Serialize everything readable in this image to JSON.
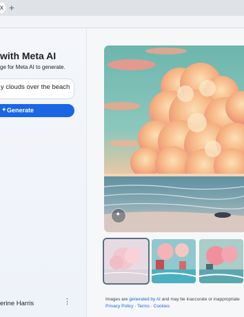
{
  "browser": {
    "tab_close": "x",
    "new_tab": "+"
  },
  "sidebar": {
    "title": "with Meta AI",
    "subtitle": "ge for Meta AI to generate.",
    "prompt_value": "y clouds over the beach",
    "generate_label": "Generate",
    "user_name": "erine Harris",
    "more_label": "⋮"
  },
  "main": {
    "disclaimer_pre": "Images are ",
    "disclaimer_link": "generated by AI",
    "disclaimer_post": " and may be inaccurate or inappropriate",
    "privacy": "Privacy Policy",
    "sep": " · ",
    "terms": "Terms",
    "cookies": "Cookies"
  },
  "colors": {
    "accent": "#1a66e5",
    "sky": "#6bb8b0",
    "cloud": "#f5b07a",
    "sea": "#5a9aa8"
  }
}
